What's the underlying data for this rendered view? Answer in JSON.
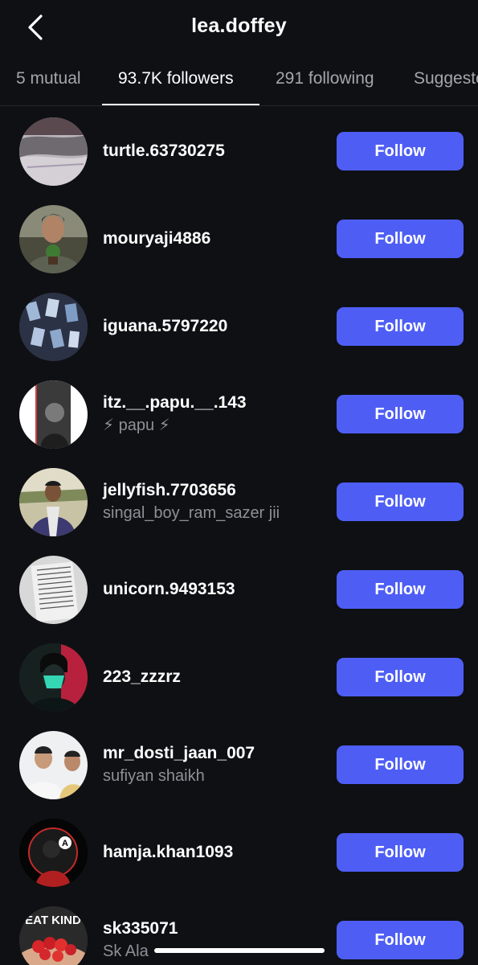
{
  "header": {
    "title": "lea.doffey"
  },
  "tabs": [
    {
      "label": "5 mutual",
      "active": false
    },
    {
      "label": "93.7K followers",
      "active": true
    },
    {
      "label": "291 following",
      "active": false
    },
    {
      "label": "Suggested",
      "active": false
    }
  ],
  "follow_label": "Follow",
  "users": [
    {
      "username": "turtle.63730275",
      "subtitle": ""
    },
    {
      "username": "mouryaji4886",
      "subtitle": ""
    },
    {
      "username": "iguana.5797220",
      "subtitle": ""
    },
    {
      "username": "itz.__.papu.__.143",
      "subtitle": "⚡ papu ⚡"
    },
    {
      "username": "jellyfish.7703656",
      "subtitle": "singal_boy_ram_sazer jii"
    },
    {
      "username": "unicorn.9493153",
      "subtitle": ""
    },
    {
      "username": "223_zzzrz",
      "subtitle": ""
    },
    {
      "username": "mr_dosti_jaan_007",
      "subtitle": "sufiyan shaikh"
    },
    {
      "username": "hamja.khan1093",
      "subtitle": ""
    },
    {
      "username": "sk335071",
      "subtitle": "Sk Ala"
    }
  ],
  "avatar_art": {
    "eat_kind_text": "EAT KIND",
    "badge_letter": "A"
  },
  "colors": {
    "background": "#0f1014",
    "follow_button": "#4e5ef5",
    "secondary_text": "#8e9097"
  }
}
